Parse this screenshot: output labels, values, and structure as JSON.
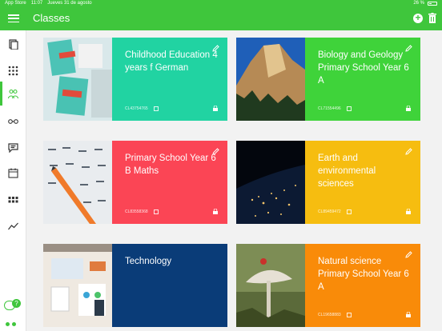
{
  "statusbar": {
    "left": "App Store",
    "time": "11:07",
    "date": "Jueves 31 de agosto",
    "battery": "26 %"
  },
  "header": {
    "title": "Classes"
  },
  "classes": [
    {
      "title": "Childhood Education 4 years f German",
      "code": "CL43754765"
    },
    {
      "title": "Biology and Geology Primary School Year 6 A",
      "code": "CL71554496"
    },
    {
      "title": "Primary School Year 6 B Maths",
      "code": "CL83558368"
    },
    {
      "title": "Earth and environmental sciences",
      "code": "CL89459472"
    },
    {
      "title": "Technology",
      "code": ""
    },
    {
      "title": "Natural science Primary School Year 6 A",
      "code": "CL19658883"
    }
  ],
  "help": {
    "badge": "?"
  }
}
